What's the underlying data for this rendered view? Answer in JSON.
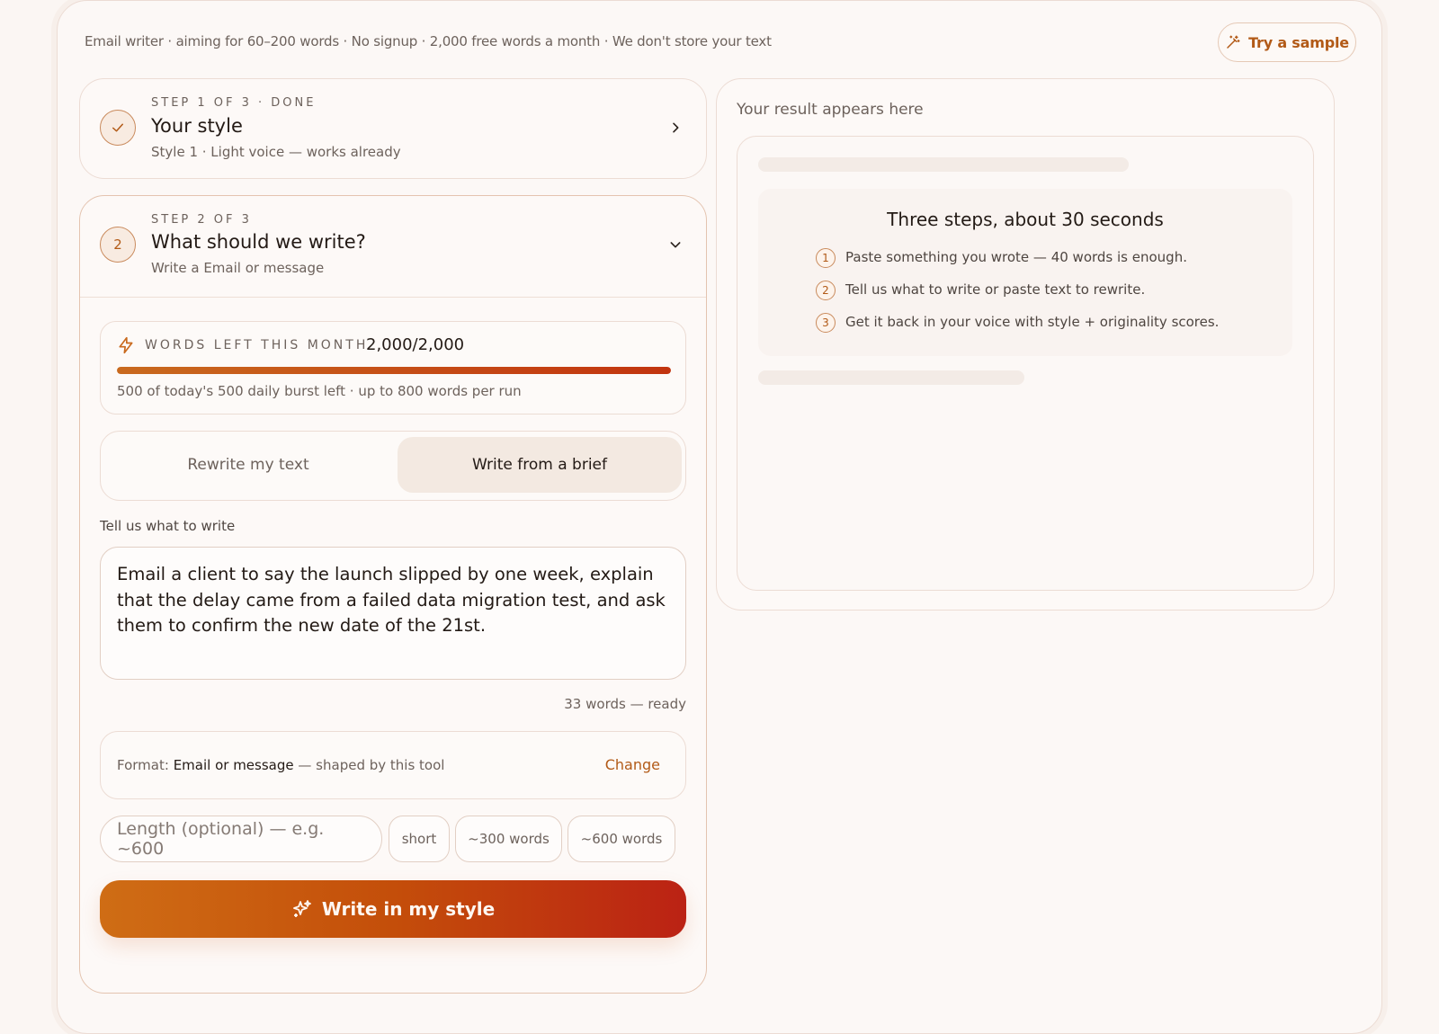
{
  "topbar": {
    "info": "Email writer · aiming for 60–200 words · No signup · 2,000 free words a month · We don't store your text",
    "sample_button": "Try a sample"
  },
  "step1": {
    "eyebrow": "STEP 1 OF 3 · DONE",
    "title": "Your style",
    "subtitle": "Style 1 · Light voice — works already"
  },
  "step2": {
    "number": "2",
    "eyebrow": "STEP 2 OF 3",
    "title": "What should we write?",
    "subtitle": "Write a Email or message",
    "words": {
      "label": "WORDS LEFT THIS MONTH",
      "count": "2,000/2,000",
      "fraction_left": 1.0,
      "note": "500 of today's 500 daily burst left · up to 800 words per run"
    },
    "mode_toggle": {
      "rewrite": "Rewrite my text",
      "brief": "Write from a brief",
      "selected": "brief"
    },
    "brief_label": "Tell us what to write",
    "brief_text": "Email a client to say the launch slipped by one week, explain that the delay came from a failed data migration test, and ask them to confirm the new date of the 21st.",
    "word_status": "33 words — ready",
    "format": {
      "prefix": "Format:",
      "value": "Email or message",
      "suffix": "— shaped by this tool",
      "change": "Change"
    },
    "length": {
      "placeholder": "Length (optional) — e.g. ~600",
      "chips": [
        "short",
        "~300 words",
        "~600 words"
      ]
    },
    "submit": "Write in my style"
  },
  "result": {
    "title": "Your result appears here",
    "steps_heading": "Three steps, about 30 seconds",
    "steps": [
      {
        "num": "1",
        "text": "Paste something you wrote — 40 words is enough."
      },
      {
        "num": "2",
        "text": "Tell us what to write or paste text to rewrite."
      },
      {
        "num": "3",
        "text": "Get it back in your voice with style + originality scores."
      }
    ]
  },
  "colors": {
    "accent": "#b25a17",
    "gradient_start": "#cf6d15",
    "gradient_end": "#bb2214",
    "background": "#fbf6f3"
  }
}
